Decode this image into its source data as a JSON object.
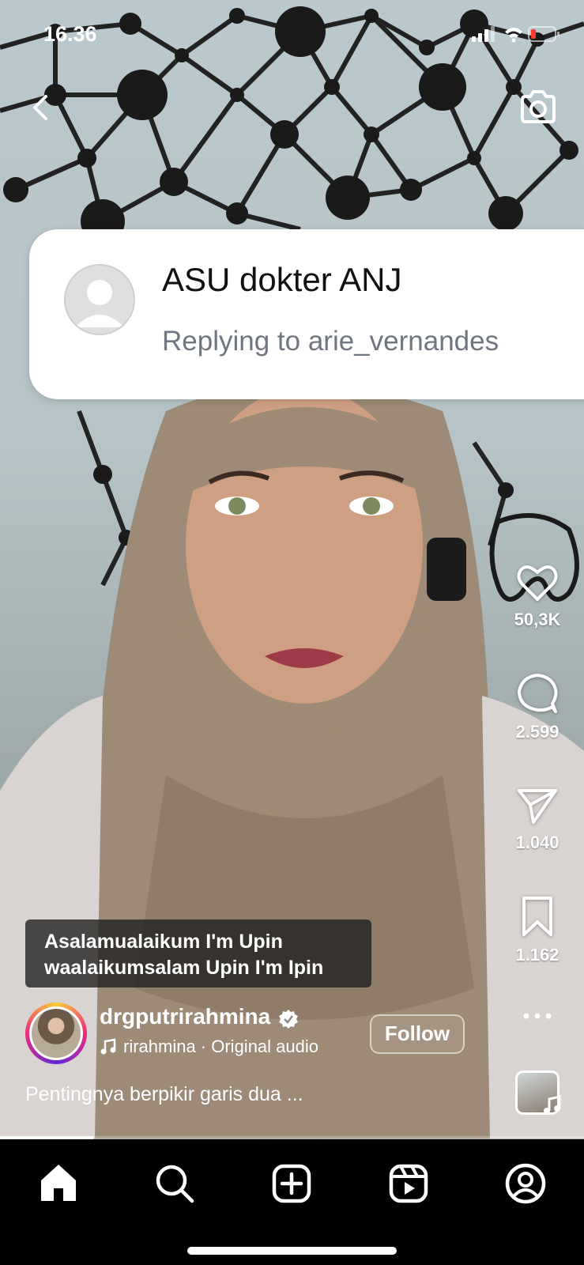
{
  "status_bar": {
    "time": "16.36"
  },
  "reply_card": {
    "name": "ASU dokter ANJ",
    "subtitle": "Replying to arie_vernandes"
  },
  "actions": {
    "likes": "50,3K",
    "comments": "2.599",
    "shares": "1.040",
    "saves": "1.162"
  },
  "caption": {
    "line1": "Asalamualaikum I'm Upin",
    "line2": "waalaikumsalam Upin I'm Ipin"
  },
  "author": {
    "username": "drgputrirahmina",
    "audio": "rirahmina · Original audio",
    "follow_label": "Follow",
    "description": "Pentingnya berpikir garis dua ..."
  },
  "video_progress": 0.16,
  "nav": {
    "items": [
      "home-icon",
      "search-icon",
      "create-icon",
      "reels-icon",
      "profile-icon"
    ]
  }
}
